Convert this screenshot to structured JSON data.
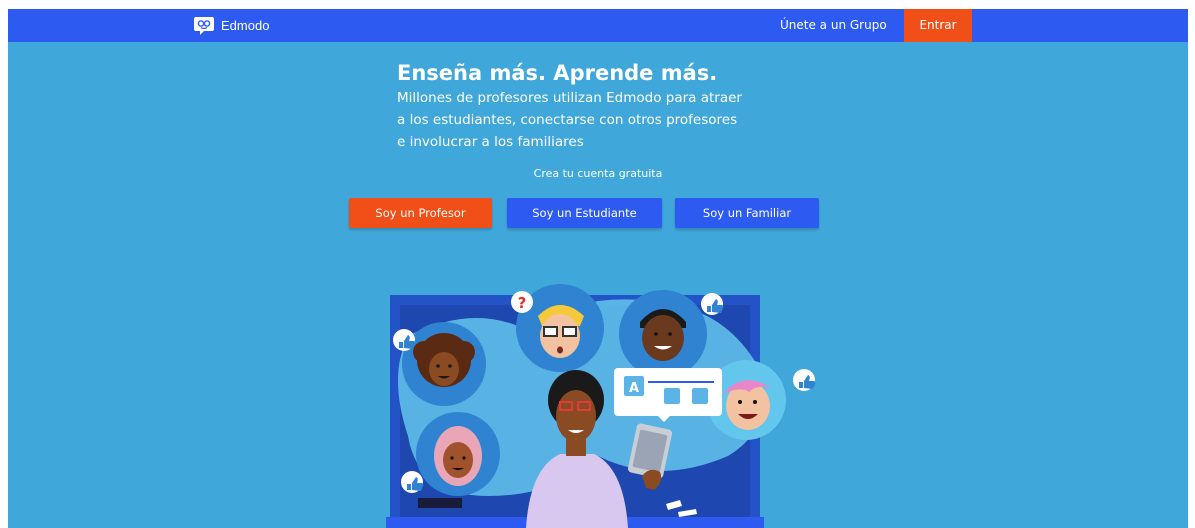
{
  "navbar": {
    "brand": "Edmodo",
    "join_group": "Únete a un Grupo",
    "login": "Entrar"
  },
  "hero": {
    "title": "Enseña más. Aprende más.",
    "subtitle_lines": [
      "Millones de profesores utilizan Edmodo para atraer",
      "a los estudiantes, conectarse con otros profesores",
      "e involucrar a los familiares"
    ],
    "cta_label": "Crea tu cuenta gratuita",
    "buttons": {
      "teacher": "Soy un Profesor",
      "student": "Soy un Estudiante",
      "parent": "Soy un Familiar"
    }
  },
  "illustration": {
    "question_mark": "?",
    "chart_card_letter": "A"
  },
  "colors": {
    "background": "#3fa7d9",
    "navbar": "#2d5bf2",
    "accent_orange": "#f04f17",
    "button_blue": "#2d5bf2"
  },
  "icons": [
    "edmodo-logo-icon",
    "thumbs-up-icon",
    "question-icon",
    "tablet-icon"
  ]
}
